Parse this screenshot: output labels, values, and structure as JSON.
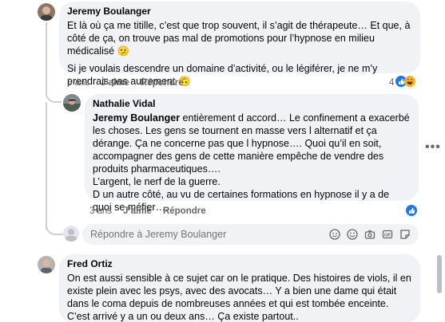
{
  "comments": [
    {
      "author": "Jeremy Boulanger",
      "paragraphs": [
        "Et là où ça me titille, c’est que trop souvent, il s’agit de thérapeute… Et que, à côté de ça, on trouve pas mal de promotions pour l’hypnose en milieu médicalisé 🫤",
        "Si je voulais descendre un domaine d’activité, ou le légiférer, je ne m’y prendrais pas autrement 🙃"
      ],
      "time": "3 ans",
      "like_label": "J’aime",
      "reply_label": "Répondre",
      "reaction_count": "4"
    },
    {
      "author": "Nathalie Vidal",
      "mention": "Jeremy Boulanger",
      "text_after_mention": " entièrement d accord… Le confinement a exacerbé les choses. Les gens se tournent en masse vers l alternatif et ça dérange. Ça ne concerne pas que l hypnose…. Quoi qu’il en soit, accompagner des gens de cette manière empêche de vendre des produits pharmaceutiques….",
      "line2": "L’argent, le nerf de la guerre.",
      "line3": "D un autre côté, au vu de certaines formations en hypnose il y a de quoi se méfier….",
      "time": "3 ans",
      "like_label": "J’aime",
      "reply_label": "Répondre"
    },
    {
      "author": "Fred Ortiz",
      "text": "On est aussi sensible à ce sujet car on le pratique. Des histoires de viols, il en existe plein avec les psys, avec des avocats… Y a bien une dame qui était dans le coma depuis de nombreuses années et qui est tombée enceinte. C’est arrivé y a un ou deux ans… Ça existe partout.."
    }
  ],
  "reply_box": {
    "placeholder": "Répondre à Jeremy Boulanger"
  },
  "more_options": "•••",
  "colors": {
    "bubble": "#f0f2f5",
    "like_blue": "#1877f2",
    "secondary_text": "#65676b"
  },
  "icons": [
    "avatar-sticker-icon",
    "emoji-icon",
    "camera-icon",
    "gif-icon",
    "sticker-icon",
    "like-reaction-icon",
    "haha-reaction-icon"
  ]
}
